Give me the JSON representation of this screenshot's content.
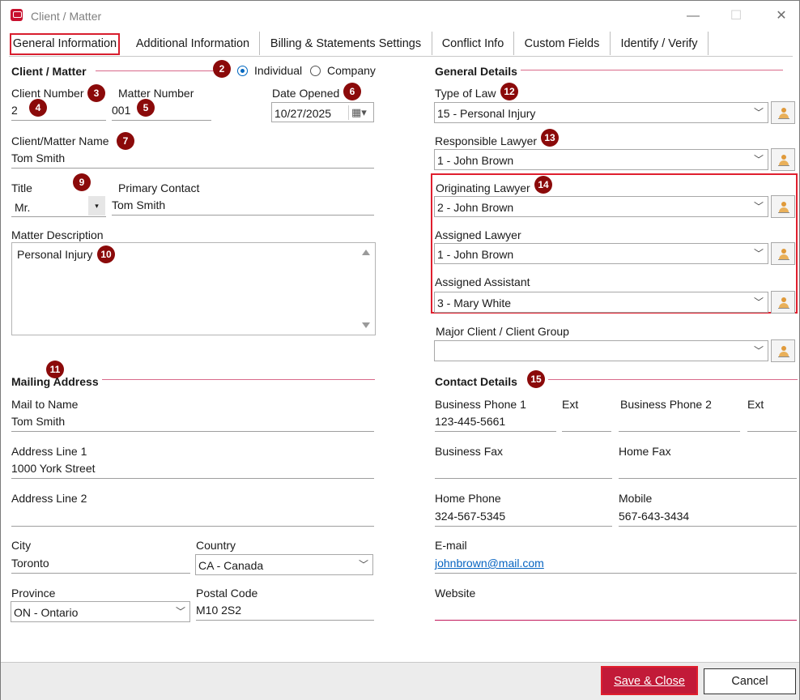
{
  "window": {
    "title": "Client / Matter",
    "minimize": "—",
    "maximize": "☐",
    "close": "✕"
  },
  "tabs": [
    {
      "label": "General Information"
    },
    {
      "label": "Additional Information"
    },
    {
      "label": "Billing & Statements Settings"
    },
    {
      "label": "Conflict Info"
    },
    {
      "label": "Custom Fields"
    },
    {
      "label": "Identify / Verify"
    }
  ],
  "client_matter": {
    "section_title": "Client / Matter",
    "type_options": {
      "individual": "Individual",
      "company": "Company",
      "selected": "Individual"
    },
    "client_number_label": "Client Number",
    "client_number": "2",
    "matter_number_label": "Matter Number",
    "matter_number": "001",
    "date_opened_label": "Date Opened",
    "date_opened": "10/27/2025",
    "name_label": "Client/Matter Name",
    "name": "Tom Smith",
    "title_label": "Title",
    "title": "Mr.",
    "primary_contact_label": "Primary Contact",
    "primary_contact": "Tom Smith",
    "description_label": "Matter Description",
    "description": "Personal Injury"
  },
  "mailing": {
    "section_title": "Mailing Address",
    "mail_to_label": "Mail to Name",
    "mail_to": "Tom Smith",
    "addr1_label": "Address Line 1",
    "addr1": "1000 York Street",
    "addr2_label": "Address Line 2",
    "addr2": "",
    "city_label": "City",
    "city": "Toronto",
    "country_label": "Country",
    "country": "CA - Canada",
    "province_label": "Province",
    "province": "ON - Ontario",
    "postal_label": "Postal Code",
    "postal": "M10 2S2"
  },
  "general_details": {
    "section_title": "General Details",
    "type_of_law_label": "Type of Law",
    "type_of_law": "15 - Personal Injury",
    "responsible_label": "Responsible Lawyer",
    "responsible": "1 - John Brown",
    "originating_label": "Originating Lawyer",
    "originating": "2 - John Brown",
    "assigned_label": "Assigned Lawyer",
    "assigned": "1 - John Brown",
    "assistant_label": "Assigned Assistant",
    "assistant": "3 - Mary White",
    "major_client_label": "Major Client / Client Group",
    "major_client": ""
  },
  "contact": {
    "section_title": "Contact Details",
    "bp1_label": "Business Phone 1",
    "bp1": "123-445-5661",
    "ext1_label": "Ext",
    "ext1": "",
    "bp2_label": "Business Phone 2",
    "bp2": "",
    "ext2_label": "Ext",
    "ext2": "",
    "bfax_label": "Business Fax",
    "bfax": "",
    "hfax_label": "Home Fax",
    "hfax": "",
    "hphone_label": "Home Phone",
    "hphone": "324-567-5345",
    "mobile_label": "Mobile",
    "mobile": "567-643-3434",
    "email_label": "E-mail",
    "email": "johnbrown@mail.com",
    "website_label": "Website",
    "website": ""
  },
  "badges": [
    "2",
    "3",
    "4",
    "5",
    "6",
    "7",
    "9",
    "10",
    "11",
    "12",
    "13",
    "14",
    "15"
  ],
  "footer": {
    "save": "Save & Close",
    "cancel": "Cancel"
  },
  "colors": {
    "accent_red": "#e01f2e",
    "badge": "#8b0a0a",
    "save_button": "#c21a38",
    "link": "#0563c1",
    "radio": "#0067c0"
  }
}
